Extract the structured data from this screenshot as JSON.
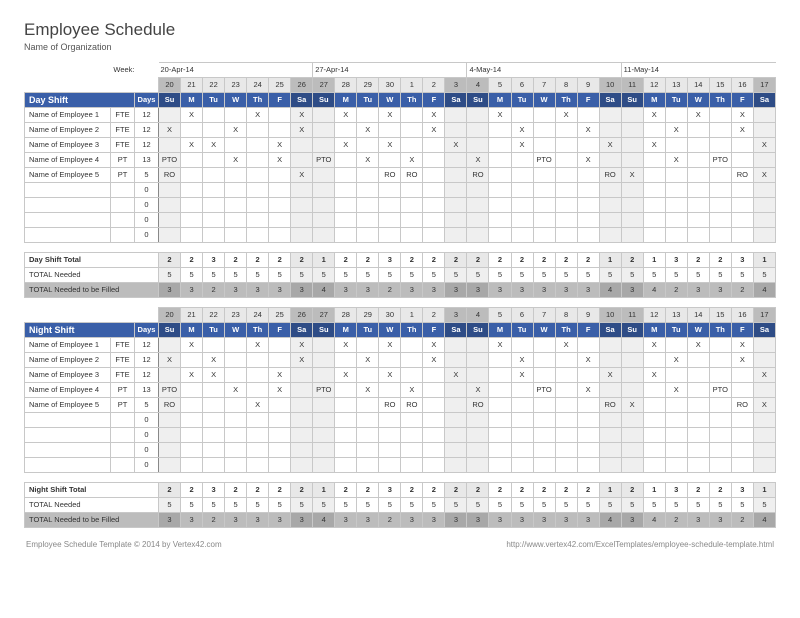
{
  "title": "Employee Schedule",
  "subtitle": "Name of Organization",
  "week_label": "Week:",
  "week_starts": [
    "20-Apr-14",
    "27-Apr-14",
    "4-May-14",
    "11-May-14"
  ],
  "day_numbers": [
    20,
    21,
    22,
    23,
    24,
    25,
    26,
    27,
    28,
    29,
    30,
    1,
    2,
    3,
    4,
    5,
    6,
    7,
    8,
    9,
    10,
    11,
    12,
    13,
    14,
    15,
    16,
    17
  ],
  "day_names": [
    "Su",
    "M",
    "Tu",
    "W",
    "Th",
    "F",
    "Sa",
    "Su",
    "M",
    "Tu",
    "W",
    "Th",
    "F",
    "Sa",
    "Su",
    "M",
    "Tu",
    "W",
    "Th",
    "F",
    "Sa",
    "Su",
    "M",
    "Tu",
    "W",
    "Th",
    "F",
    "Sa"
  ],
  "weekend_idx": [
    0,
    6,
    7,
    13,
    14,
    20,
    21,
    27
  ],
  "days_col_label": "Days",
  "shifts": [
    {
      "name": "Day Shift",
      "employees": [
        {
          "name": "Name of Employee 1",
          "type": "FTE",
          "days": 12,
          "marks": [
            "",
            "X",
            "",
            "",
            "X",
            "",
            "X",
            "",
            "X",
            "",
            "X",
            "",
            "X",
            "",
            "",
            "X",
            "",
            "",
            "X",
            "",
            "",
            "",
            "X",
            "",
            "X",
            "",
            "X",
            ""
          ]
        },
        {
          "name": "Name of Employee 2",
          "type": "FTE",
          "days": 12,
          "marks": [
            "X",
            "",
            "",
            "X",
            "",
            "",
            "X",
            "",
            "",
            "X",
            "",
            "",
            "X",
            "",
            "",
            "",
            "X",
            "",
            "",
            "X",
            "",
            "",
            "",
            "X",
            "",
            "",
            "X",
            ""
          ]
        },
        {
          "name": "Name of Employee 3",
          "type": "FTE",
          "days": 12,
          "marks": [
            "",
            "X",
            "X",
            "",
            "",
            "X",
            "",
            "",
            "X",
            "",
            "X",
            "",
            "",
            "X",
            "",
            "",
            "X",
            "",
            "",
            "",
            "X",
            "",
            "X",
            "",
            "",
            "",
            "",
            "X"
          ]
        },
        {
          "name": "Name of Employee 4",
          "type": "PT",
          "days": 13,
          "marks": [
            "PTO",
            "",
            "",
            "X",
            "",
            "X",
            "",
            "PTO",
            "",
            "X",
            "",
            "X",
            "",
            "",
            "X",
            "",
            "",
            "PTO",
            "",
            "X",
            "",
            "",
            "",
            "X",
            "",
            "PTO",
            "",
            ""
          ]
        },
        {
          "name": "Name of Employee 5",
          "type": "PT",
          "days": 5,
          "marks": [
            "RO",
            "",
            "",
            "",
            "",
            "",
            "X",
            "",
            "",
            "",
            "RO",
            "RO",
            "",
            "",
            "RO",
            "",
            "",
            "",
            "",
            "",
            "RO",
            "X",
            "",
            "",
            "",
            "",
            "RO",
            "X"
          ]
        }
      ],
      "empty_rows": 4,
      "totals": [
        {
          "label": "Day Shift Total",
          "class": "tot1",
          "bold": true,
          "vals": [
            2,
            2,
            3,
            2,
            2,
            2,
            2,
            1,
            2,
            2,
            3,
            2,
            2,
            2,
            2,
            2,
            2,
            2,
            2,
            2,
            1,
            2,
            1,
            3,
            2,
            2,
            3,
            1
          ]
        },
        {
          "label": "TOTAL Needed",
          "class": "tot2",
          "bold": false,
          "vals": [
            5,
            5,
            5,
            5,
            5,
            5,
            5,
            5,
            5,
            5,
            5,
            5,
            5,
            5,
            5,
            5,
            5,
            5,
            5,
            5,
            5,
            5,
            5,
            5,
            5,
            5,
            5,
            5
          ]
        },
        {
          "label": "TOTAL Needed to be Filled",
          "class": "tot3",
          "bold": false,
          "vals": [
            3,
            3,
            2,
            3,
            3,
            3,
            3,
            4,
            3,
            3,
            2,
            3,
            3,
            3,
            3,
            3,
            3,
            3,
            3,
            3,
            4,
            3,
            4,
            2,
            3,
            3,
            2,
            4
          ]
        }
      ]
    },
    {
      "name": "Night Shift",
      "employees": [
        {
          "name": "Name of Employee 1",
          "type": "FTE",
          "days": 12,
          "marks": [
            "",
            "X",
            "",
            "",
            "X",
            "",
            "X",
            "",
            "X",
            "",
            "X",
            "",
            "X",
            "",
            "",
            "X",
            "",
            "",
            "X",
            "",
            "",
            "",
            "X",
            "",
            "X",
            "",
            "X",
            ""
          ]
        },
        {
          "name": "Name of Employee 2",
          "type": "FTE",
          "days": 12,
          "marks": [
            "X",
            "",
            "X",
            "",
            "",
            "",
            "X",
            "",
            "",
            "X",
            "",
            "",
            "X",
            "",
            "",
            "",
            "X",
            "",
            "",
            "X",
            "",
            "",
            "",
            "X",
            "",
            "",
            "X",
            ""
          ]
        },
        {
          "name": "Name of Employee 3",
          "type": "FTE",
          "days": 12,
          "marks": [
            "",
            "X",
            "X",
            "",
            "",
            "X",
            "",
            "",
            "X",
            "",
            "X",
            "",
            "",
            "X",
            "",
            "",
            "X",
            "",
            "",
            "",
            "X",
            "",
            "X",
            "",
            "",
            "",
            "",
            "X"
          ]
        },
        {
          "name": "Name of Employee 4",
          "type": "PT",
          "days": 13,
          "marks": [
            "PTO",
            "",
            "",
            "X",
            "",
            "X",
            "",
            "PTO",
            "",
            "X",
            "",
            "X",
            "",
            "",
            "X",
            "",
            "",
            "PTO",
            "",
            "X",
            "",
            "",
            "",
            "X",
            "",
            "PTO",
            "",
            ""
          ]
        },
        {
          "name": "Name of Employee 5",
          "type": "PT",
          "days": 5,
          "marks": [
            "RO",
            "",
            "",
            "",
            "X",
            "",
            "",
            "",
            "",
            "",
            "RO",
            "RO",
            "",
            "",
            "RO",
            "",
            "",
            "",
            "",
            "",
            "RO",
            "X",
            "",
            "",
            "",
            "",
            "RO",
            "X"
          ]
        }
      ],
      "empty_rows": 4,
      "totals": [
        {
          "label": "Night Shift Total",
          "class": "tot1",
          "bold": true,
          "vals": [
            2,
            2,
            3,
            2,
            2,
            2,
            2,
            1,
            2,
            2,
            3,
            2,
            2,
            2,
            2,
            2,
            2,
            2,
            2,
            2,
            1,
            2,
            1,
            3,
            2,
            2,
            3,
            1
          ]
        },
        {
          "label": "TOTAL Needed",
          "class": "tot2",
          "bold": false,
          "vals": [
            5,
            5,
            5,
            5,
            5,
            5,
            5,
            5,
            5,
            5,
            5,
            5,
            5,
            5,
            5,
            5,
            5,
            5,
            5,
            5,
            5,
            5,
            5,
            5,
            5,
            5,
            5,
            5
          ]
        },
        {
          "label": "TOTAL Needed to be Filled",
          "class": "tot3",
          "bold": false,
          "vals": [
            3,
            3,
            2,
            3,
            3,
            3,
            3,
            4,
            3,
            3,
            2,
            3,
            3,
            3,
            3,
            3,
            3,
            3,
            3,
            3,
            4,
            3,
            4,
            2,
            3,
            3,
            2,
            4
          ]
        }
      ]
    }
  ],
  "footer_left": "Employee Schedule Template © 2014 by Vertex42.com",
  "footer_right": "http://www.vertex42.com/ExcelTemplates/employee-schedule-template.html"
}
